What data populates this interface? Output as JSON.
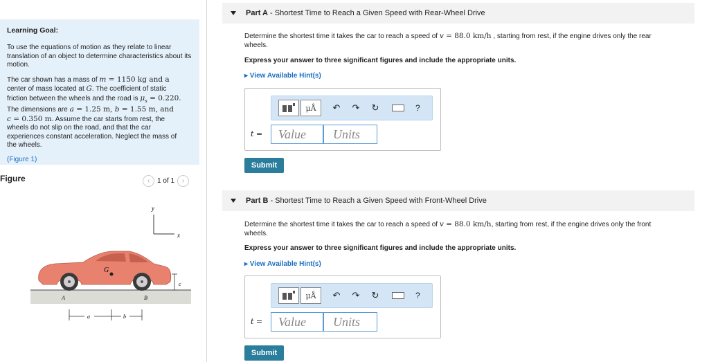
{
  "learning_goal": {
    "title": "Learning Goal:",
    "paragraph1": "To use the equations of motion as they relate to linear translation of an object to determine characteristics about its motion.",
    "p2_l1a": "The car shown has a mass of ",
    "p2_m": "m",
    "p2_l1b": " = 1150 kg and a",
    "p2_l2a": "center of mass located at ",
    "p2_G": "G",
    "p2_l2b": ". The coefficient of static",
    "p2_l3a": "friction between the wheels and the road is ",
    "p2_mu": "μ",
    "p2_s": "s",
    "p2_l3b": " = 0.220.",
    "p2_l4a": "The dimensions are ",
    "p2_a": "a",
    "p2_l4b": " = 1.25 m, ",
    "p2_b": "b",
    "p2_l4c": " = 1.55 m, and",
    "p2_c": "c",
    "p2_l5a": " = 0.350 m",
    "p2_l5b": ". Assume the car starts from rest, the",
    "p2_l6": "wheels do not slip on the road, and that the car",
    "p2_l7": "experiences constant acceleration. Neglect the mass of",
    "p2_l8": "the wheels.",
    "figure_link": "(Figure 1)"
  },
  "figure": {
    "title": "Figure",
    "pager_text": "1 of 1",
    "label_y": "y",
    "label_x": "x",
    "label_G": "G",
    "label_A": "A",
    "label_B": "B",
    "label_a": "a",
    "label_b": "b",
    "label_c": "c",
    "car_color": "#e8826f"
  },
  "parts": [
    {
      "prefix": "Part A",
      "title": " - Shortest Time to Reach a Given Speed with Rear-Wheel Drive",
      "desc_a": "Determine the shortest time it takes the car to reach a speed of ",
      "desc_v": "v",
      "desc_b": " = 88.0 km/h",
      "desc_c": " , starting from rest, if the engine drives only the rear",
      "desc_d": "wheels.",
      "express": "Express your answer to three significant figures and include the appropriate units.",
      "hints": "▸ View Available Hint(s)",
      "var_label": "t =",
      "value_placeholder": "Value",
      "units_placeholder": "Units",
      "submit": "Submit"
    },
    {
      "prefix": "Part B",
      "title": " - Shortest Time to Reach a Given Speed with Front-Wheel Drive",
      "desc_a": "Determine the shortest time it takes the car to reach a speed of ",
      "desc_v": "v",
      "desc_b": " = 88.0 km/h",
      "desc_c": ", starting from rest, if the engine drives only the front",
      "desc_d": "wheels.",
      "express": "Express your answer to three significant figures and include the appropriate units.",
      "hints": "▸ View Available Hint(s)",
      "var_label": "t =",
      "value_placeholder": "Value",
      "units_placeholder": "Units",
      "submit": "Submit"
    }
  ],
  "toolbar": {
    "mu_label": "μÅ",
    "undo": "↶",
    "redo": "↷",
    "reset": "↻",
    "help": "?"
  }
}
